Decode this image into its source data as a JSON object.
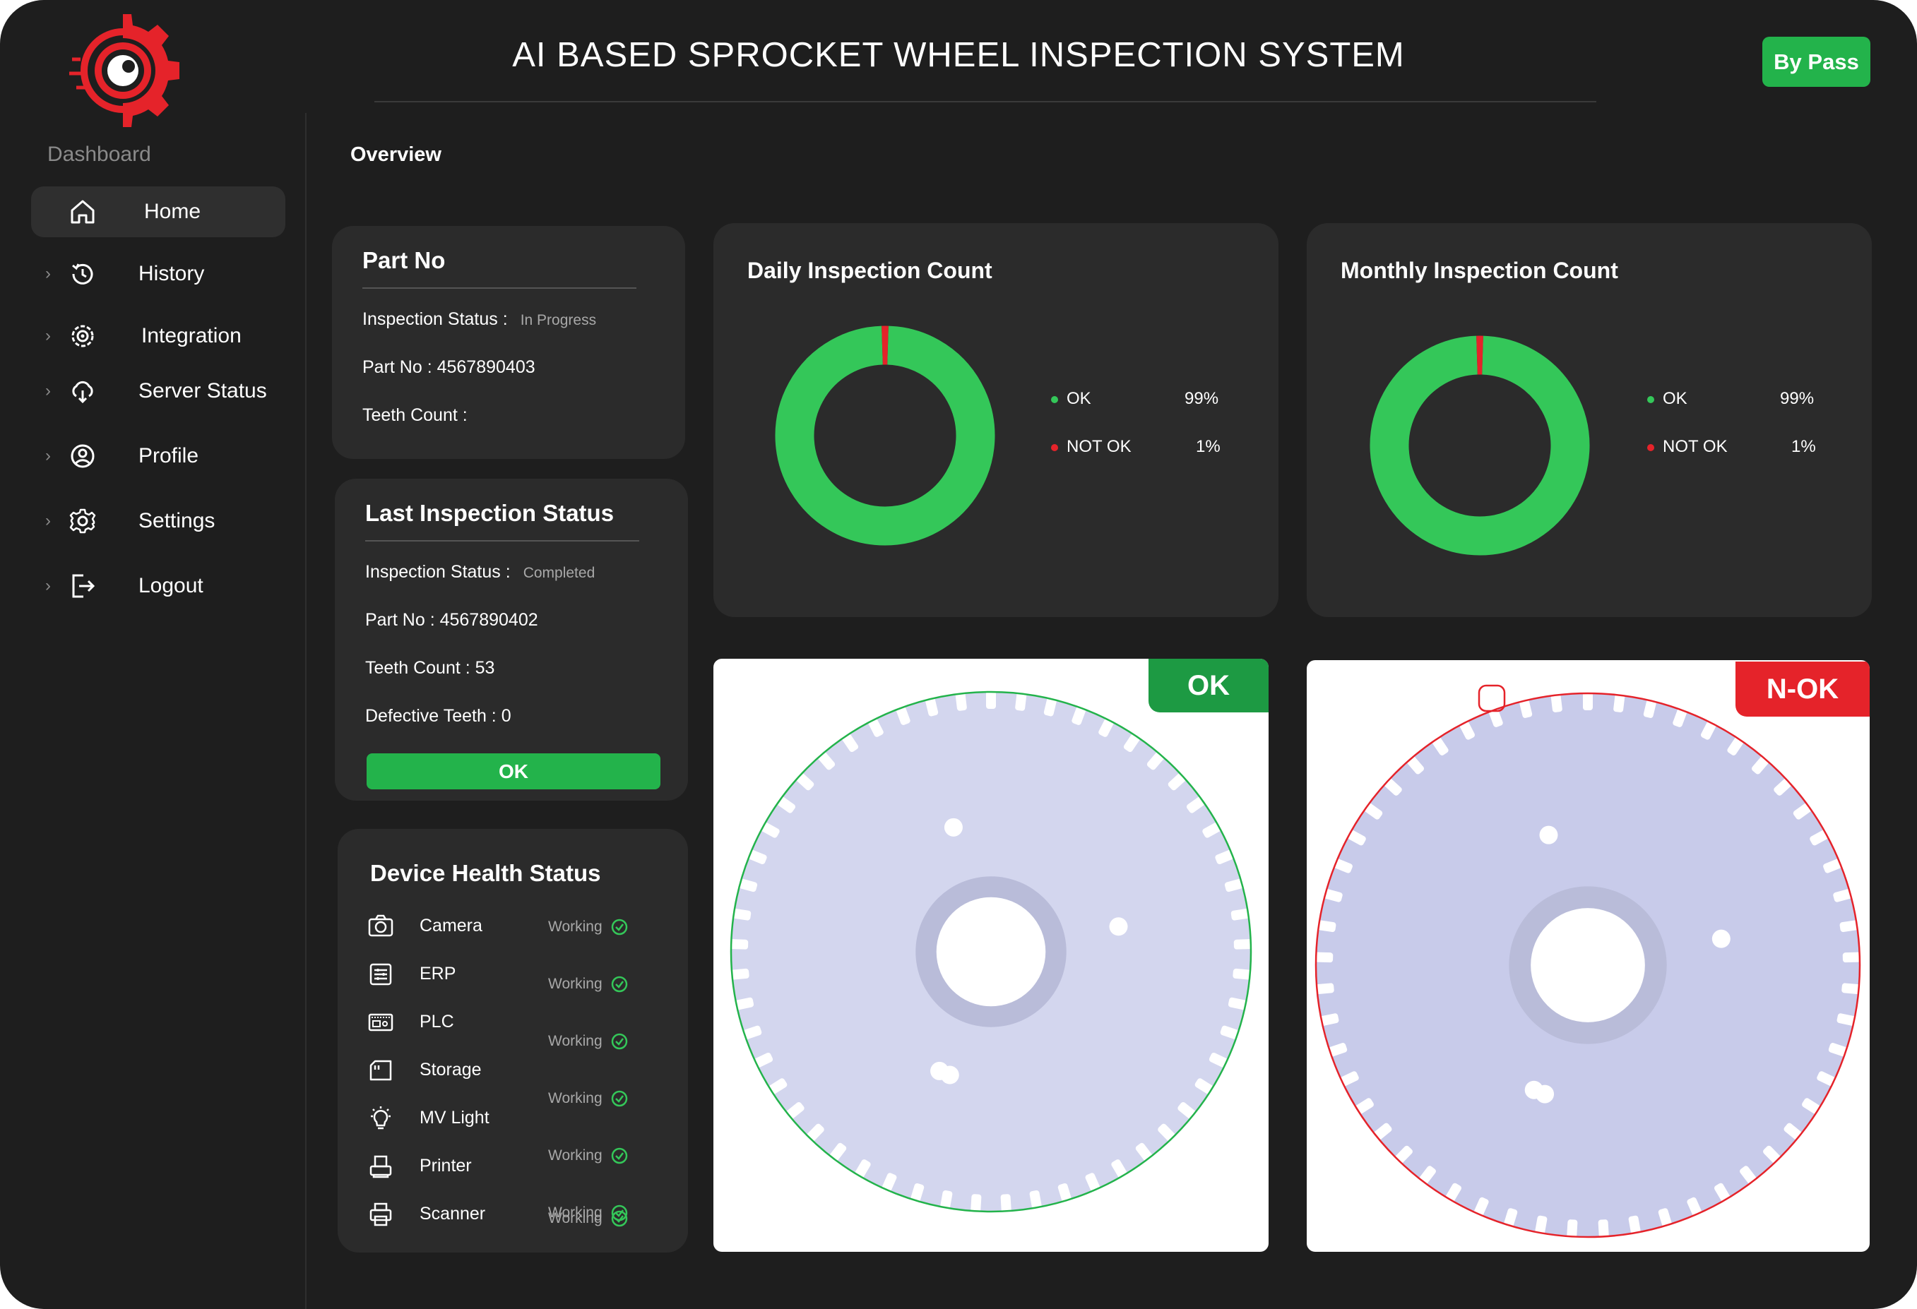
{
  "app": {
    "title": "AI BASED SPROCKET WHEEL INSPECTION SYSTEM",
    "bypass_label": "By Pass"
  },
  "sidebar": {
    "section_label": "Dashboard",
    "items": [
      {
        "label": "Home",
        "icon": "home-icon"
      },
      {
        "label": "History",
        "icon": "history-icon"
      },
      {
        "label": "Integration",
        "icon": "integration-icon"
      },
      {
        "label": "Server Status",
        "icon": "server-status-icon"
      },
      {
        "label": "Profile",
        "icon": "profile-icon"
      },
      {
        "label": "Settings",
        "icon": "gear-icon"
      },
      {
        "label": "Logout",
        "icon": "logout-icon"
      }
    ]
  },
  "main": {
    "heading": "Overview",
    "current_part": {
      "title": "Part No",
      "status_label": "Inspection Status :",
      "status_value": "In Progress",
      "part_no": "Part No : 4567890403",
      "teeth_count": "Teeth Count :"
    },
    "last_inspection": {
      "title": "Last Inspection Status",
      "status_label": "Inspection Status :",
      "status_value": "Completed",
      "part_no": "Part No : 4567890402",
      "teeth_count": "Teeth Count : 53",
      "defective_teeth": "Defective Teeth : 0",
      "result_label": "OK"
    },
    "device_health": {
      "title": "Device Health Status",
      "devices": [
        {
          "name": "Camera",
          "status": "Working",
          "icon": "camera-icon"
        },
        {
          "name": "ERP",
          "status": "Working",
          "icon": "erp-icon"
        },
        {
          "name": "PLC",
          "status": "Working",
          "icon": "plc-icon"
        },
        {
          "name": "Storage",
          "status": "Working",
          "icon": "storage-icon"
        },
        {
          "name": "MV Light",
          "status": "Working",
          "icon": "light-icon"
        },
        {
          "name": "Printer",
          "status": "Working",
          "icon": "printer-icon"
        },
        {
          "name": "Scanner",
          "status": "Working",
          "icon": "scanner-icon"
        }
      ]
    },
    "daily": {
      "title": "Daily Inspection Count",
      "ok_label": "OK",
      "ok_pct": "99%",
      "notok_label": "NOT OK",
      "notok_pct": "1%"
    },
    "monthly": {
      "title": "Monthly Inspection Count",
      "ok_label": "OK",
      "ok_pct": "99%",
      "notok_label": "NOT OK",
      "notok_pct": "1%"
    },
    "images": {
      "ok_badge": "OK",
      "nok_badge": "N-OK"
    }
  },
  "colors": {
    "background": "#1e1e1e",
    "card": "#2b2b2b",
    "ok_green": "#23b34b",
    "donut_green": "#34c759",
    "not_ok_red": "#e5232a"
  },
  "chart_data": [
    {
      "type": "pie",
      "title": "Daily Inspection Count",
      "categories": [
        "OK",
        "NOT OK"
      ],
      "values": [
        99,
        1
      ],
      "legend": "right"
    },
    {
      "type": "pie",
      "title": "Monthly Inspection Count",
      "categories": [
        "OK",
        "NOT OK"
      ],
      "values": [
        99,
        1
      ],
      "legend": "right"
    }
  ]
}
